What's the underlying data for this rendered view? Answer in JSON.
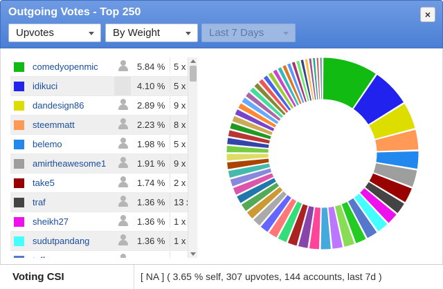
{
  "window": {
    "title": "Outgoing Votes - Top 250",
    "close_label": "×"
  },
  "filters": {
    "vote_type": "Upvotes",
    "sort_by": "By Weight",
    "period": "Last 7 Days"
  },
  "accounts": [
    {
      "name": "comedyopenmic",
      "pct": "5.84 %",
      "count": "5 x",
      "color": "#11bb11"
    },
    {
      "name": "idikuci",
      "pct": "4.10 %",
      "count": "5 x",
      "color": "#2222ee"
    },
    {
      "name": "dandesign86",
      "pct": "2.89 %",
      "count": "9 x",
      "color": "#dddd00"
    },
    {
      "name": "steemmatt",
      "pct": "2.23 %",
      "count": "8 x",
      "color": "#ff9955"
    },
    {
      "name": "belemo",
      "pct": "1.98 %",
      "count": "5 x",
      "color": "#2288ee"
    },
    {
      "name": "amirtheawesome1",
      "pct": "1.91 %",
      "count": "9 x",
      "color": "#9e9e9e"
    },
    {
      "name": "take5",
      "pct": "1.74 %",
      "count": "2 x",
      "color": "#990000"
    },
    {
      "name": "traf",
      "pct": "1.36 %",
      "count": "13 x",
      "color": "#444444"
    },
    {
      "name": "sheikh27",
      "pct": "1.36 %",
      "count": "1 x",
      "color": "#ee11ee"
    },
    {
      "name": "sudutpandang",
      "pct": "1.36 %",
      "count": "1 x",
      "color": "#44ffff"
    },
    {
      "name": "teffer",
      "pct": "",
      "count": "",
      "color": "#5577cc"
    }
  ],
  "chart_data": {
    "type": "pie",
    "values": [
      5.84,
      4.1,
      2.89,
      2.23,
      1.98,
      1.91,
      1.74,
      1.36,
      1.36,
      1.36,
      1.3,
      1.28,
      1.25,
      1.22,
      1.2,
      1.18,
      1.15,
      1.12,
      1.1,
      1.08,
      1.05,
      1.03,
      1.0,
      0.98,
      0.96,
      0.94,
      0.92,
      0.9,
      0.88,
      0.86,
      0.84,
      0.82,
      0.8,
      0.78,
      0.76,
      0.74,
      0.72,
      0.7,
      0.68,
      0.66,
      0.64,
      0.62,
      0.6,
      0.58,
      0.56,
      0.54,
      0.52,
      0.5,
      0.48,
      0.46,
      0.44,
      0.42,
      0.4,
      0.38,
      0.36,
      0.34
    ],
    "colors": [
      "#11bb11",
      "#2222ee",
      "#dddd00",
      "#ff9955",
      "#2288ee",
      "#9e9e9e",
      "#990000",
      "#444444",
      "#ee11ee",
      "#44ffff",
      "#5577cc",
      "#22cc22",
      "#88dd55",
      "#bb77ff",
      "#44aadd",
      "#ff4499",
      "#8844aa",
      "#aa2222",
      "#33dd77",
      "#ff7777",
      "#6666ff",
      "#aaaaaa",
      "#cc9933",
      "#55aa55",
      "#2277aa",
      "#dd55aa",
      "#8888dd",
      "#44bbaa",
      "#aa4400",
      "#dddd66",
      "#77cc44",
      "#3344aa",
      "#bb3333",
      "#229922",
      "#ccaa55",
      "#7744cc",
      "#ff8833",
      "#66aaff",
      "#aa66aa",
      "#44dd99",
      "#888833",
      "#ee5555",
      "#4466ee",
      "#99cc33",
      "#cc44cc",
      "#33bbbb",
      "#dd7722",
      "#5599ff",
      "#aa3377",
      "#66ee66",
      "#334488",
      "#ffbb44",
      "#995599",
      "#22aa88",
      "#cc6666",
      "#6688aa"
    ]
  },
  "footer": {
    "label": "Voting CSI",
    "value": "[ NA ] ( 3.65 % self, 307 upvotes, 144 accounts, last 7d )"
  }
}
